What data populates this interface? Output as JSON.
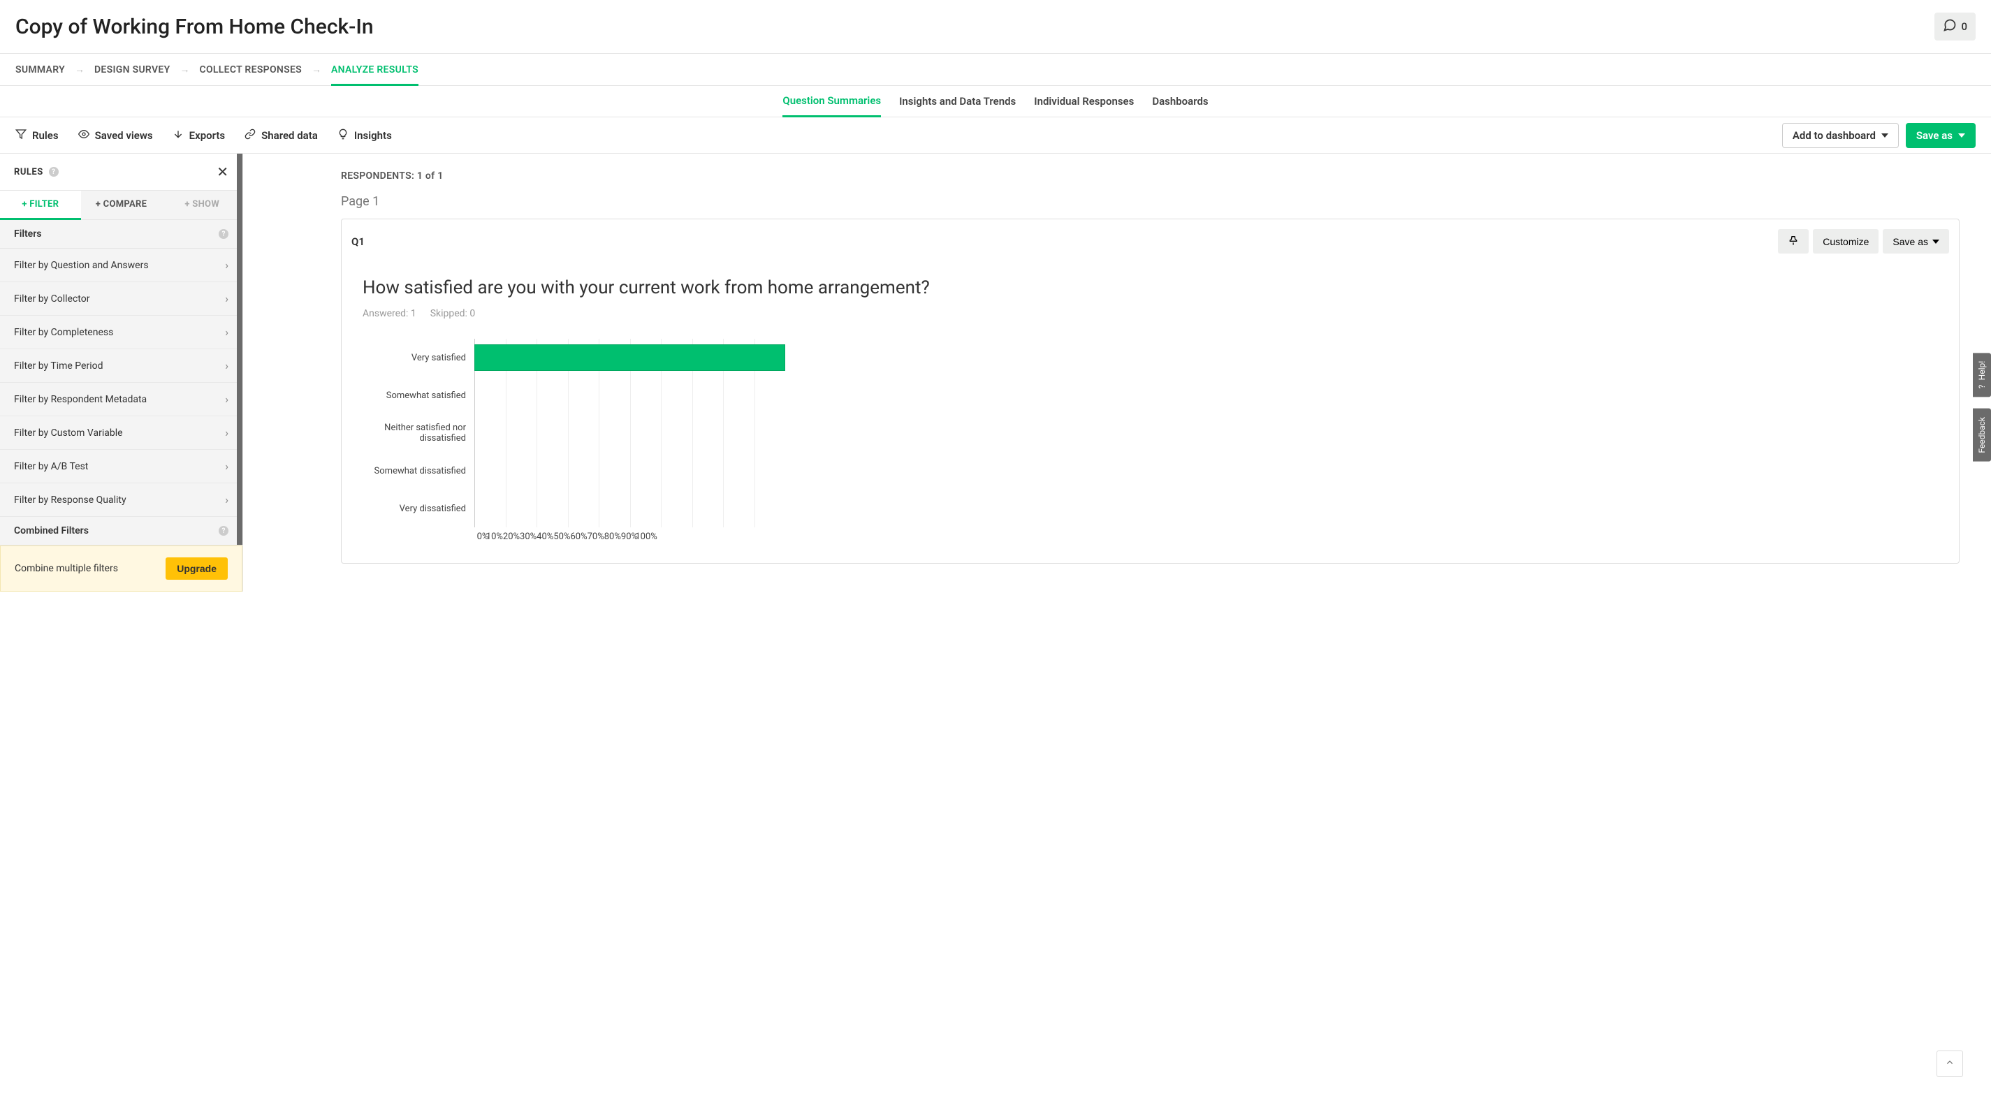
{
  "header": {
    "title": "Copy of Working From Home Check-In",
    "comment_count": "0"
  },
  "nav1": {
    "steps": [
      "SUMMARY",
      "DESIGN SURVEY",
      "COLLECT RESPONSES",
      "ANALYZE RESULTS"
    ],
    "active_index": 3
  },
  "nav2": {
    "tabs": [
      "Question Summaries",
      "Insights and Data Trends",
      "Individual Responses",
      "Dashboards"
    ],
    "active_index": 0
  },
  "toolbar": {
    "rules": "Rules",
    "saved_views": "Saved views",
    "exports": "Exports",
    "shared_data": "Shared data",
    "insights": "Insights",
    "add_dashboard": "Add to dashboard",
    "save_as": "Save as"
  },
  "sidebar": {
    "title": "RULES",
    "tabs": {
      "filter": "+ FILTER",
      "compare": "+ COMPARE",
      "show": "+ SHOW"
    },
    "group_filters": "Filters",
    "filters": [
      "Filter by Question and Answers",
      "Filter by Collector",
      "Filter by Completeness",
      "Filter by Time Period",
      "Filter by Respondent Metadata",
      "Filter by Custom Variable",
      "Filter by A/B Test",
      "Filter by Response Quality"
    ],
    "group_combined": "Combined Filters",
    "combine_label": "Combine multiple filters",
    "upgrade": "Upgrade"
  },
  "main": {
    "respondents_label": "RESPONDENTS:",
    "respondents_value": "1 of 1",
    "page_label": "Page 1",
    "q_id": "Q1",
    "customize": "Customize",
    "save_as": "Save as",
    "question_text": "How satisfied are you with your current work from home arrangement?",
    "answered_label": "Answered: 1",
    "skipped_label": "Skipped: 0"
  },
  "chart_data": {
    "type": "bar",
    "orientation": "horizontal",
    "categories": [
      "Very satisfied",
      "Somewhat satisfied",
      "Neither satisfied nor dissatisfied",
      "Somewhat dissatisfied",
      "Very dissatisfied"
    ],
    "values": [
      100,
      0,
      0,
      0,
      0
    ],
    "xlabel": "",
    "ylabel": "",
    "xlim": [
      0,
      100
    ],
    "xticks": [
      "0%",
      "10%",
      "20%",
      "30%",
      "40%",
      "50%",
      "60%",
      "70%",
      "80%",
      "90%",
      "100%"
    ]
  },
  "float": {
    "help": "Help!",
    "feedback": "Feedback"
  }
}
